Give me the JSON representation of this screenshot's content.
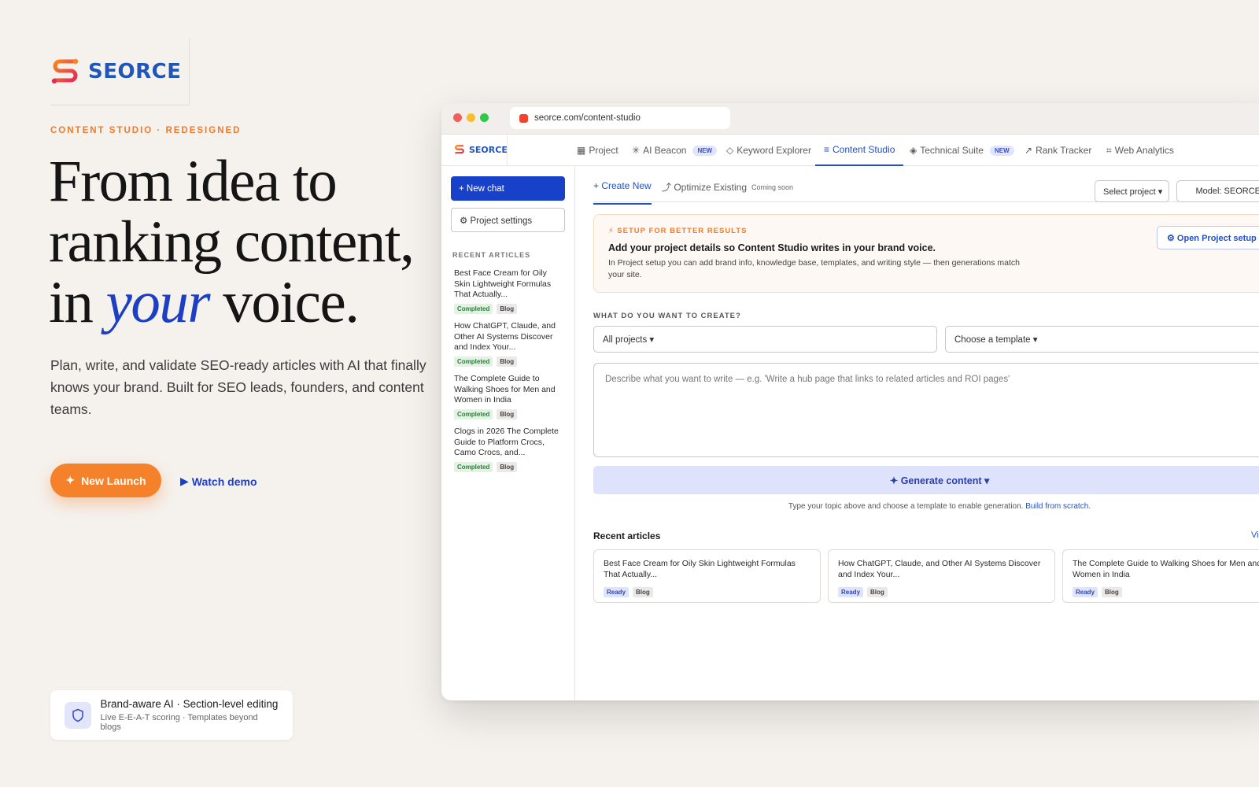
{
  "brand": {
    "name": "SEORCE",
    "accent": "#f5822b",
    "primary_blue": "#1741c9"
  },
  "hero": {
    "eyebrow": "CONTENT STUDIO · REDESIGNED",
    "headline_line1": "From idea to",
    "headline_line2": "ranking content,",
    "headline_line3_pre": "in ",
    "headline_line3_em": "your",
    "headline_line3_post": " voice.",
    "subcopy": "Plan, write, and validate SEO-ready articles with AI that finally knows your brand. Built for SEO leads, founders, and content teams.",
    "cta_primary": "New Launch",
    "cta_secondary": "Watch demo"
  },
  "feature": {
    "title": "Brand-aware AI · Section-level editing",
    "subtitle": "Live E-E-A-T scoring · Templates beyond blogs"
  },
  "browser": {
    "url": "seorce.com/content-studio"
  },
  "nav": {
    "logo": "SEORCE",
    "tabs": [
      {
        "icon": "▦",
        "label": "Project",
        "badge": ""
      },
      {
        "icon": "✳",
        "label": "AI Beacon",
        "badge": "NEW"
      },
      {
        "icon": "◇",
        "label": "Keyword Explorer",
        "badge": ""
      },
      {
        "icon": "≡",
        "label": "Content Studio",
        "badge": ""
      },
      {
        "icon": "◈",
        "label": "Technical Suite",
        "badge": "NEW"
      },
      {
        "icon": "↗",
        "label": "Rank Tracker",
        "badge": ""
      },
      {
        "icon": "⌗",
        "label": "Web Analytics",
        "badge": ""
      }
    ]
  },
  "sidebar": {
    "new_chat": "+ New chat",
    "project_settings": "⚙ Project settings",
    "heading": "RECENT ARTICLES",
    "items": [
      {
        "title": "Best Face Cream for Oily Skin Lightweight Formulas That Actually...",
        "status": "Completed",
        "type": "Blog"
      },
      {
        "title": "How ChatGPT, Claude, and Other AI Systems Discover and Index Your...",
        "status": "Completed",
        "type": "Blog"
      },
      {
        "title": "The Complete Guide to Walking Shoes for Men and Women in India",
        "status": "Completed",
        "type": "Blog"
      },
      {
        "title": "Clogs in 2026 The Complete Guide to Platform Crocs, Camo Crocs, and...",
        "status": "Completed",
        "type": "Blog"
      }
    ]
  },
  "main": {
    "tab_create": "+ Create New",
    "tab_optimize": "⤴ Optimize Existing",
    "tab_optimize_badge": "Coming soon",
    "select_project": "Select project ▾",
    "model_select": "Model: SEORCE v",
    "setup": {
      "eyebrow": "⚡ SETUP FOR BETTER RESULTS",
      "title": "Add your project details so Content Studio writes in your brand voice.",
      "desc": "In Project setup you can add brand info, knowledge base, templates, and writing style — then generations match your site.",
      "button": "⚙ Open Project setup →"
    },
    "create_heading": "WHAT DO YOU WANT TO CREATE?",
    "projects_dropdown": "All projects ▾",
    "template_dropdown": "Choose a template ▾",
    "prompt_placeholder": "Describe what you want to write — e.g. 'Write a hub page that links to related articles and ROI pages'",
    "generate": "✦ Generate content ▾",
    "helper_text": "Type your topic above and choose a template to enable generation.",
    "helper_link": "Build from scratch.",
    "recent_title": "Recent articles",
    "view_all": "Vie",
    "recent_cards": [
      {
        "title": "Best Face Cream for Oily Skin Lightweight Formulas That Actually...",
        "status": "Ready",
        "type": "Blog"
      },
      {
        "title": "How ChatGPT, Claude, and Other AI Systems Discover and Index Your...",
        "status": "Ready",
        "type": "Blog"
      },
      {
        "title": "The Complete Guide to Walking Shoes for Men and Women in India",
        "status": "Ready",
        "type": "Blog"
      }
    ]
  }
}
